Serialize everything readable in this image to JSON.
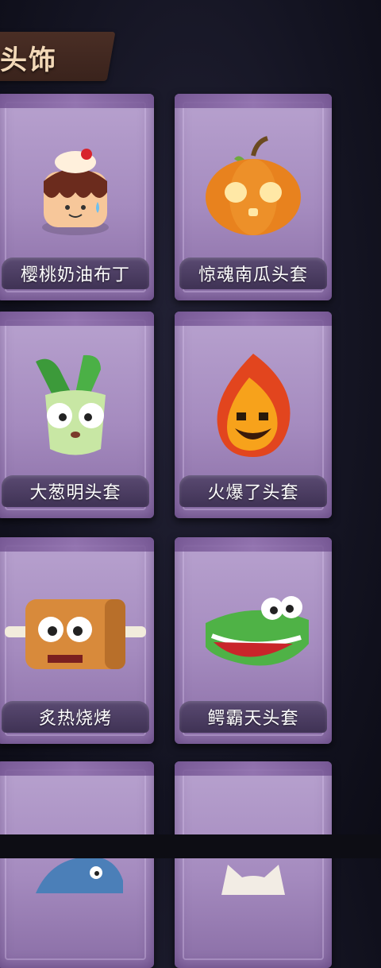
{
  "section": {
    "title": "头饰"
  },
  "items": [
    {
      "label": "樱桃奶油布丁",
      "icon": "pudding-hat-icon"
    },
    {
      "label": "惊魂南瓜头套",
      "icon": "pumpkin-hat-icon"
    },
    {
      "label": "大葱明头套",
      "icon": "scallion-hat-icon"
    },
    {
      "label": "火爆了头套",
      "icon": "fireball-hat-icon"
    },
    {
      "label": "炙热烧烤",
      "icon": "barbecue-hat-icon"
    },
    {
      "label": "鳄霸天头套",
      "icon": "crocodile-hat-icon"
    },
    {
      "label": "",
      "icon": "shark-hat-icon"
    },
    {
      "label": "",
      "icon": "cat-hat-icon"
    }
  ]
}
